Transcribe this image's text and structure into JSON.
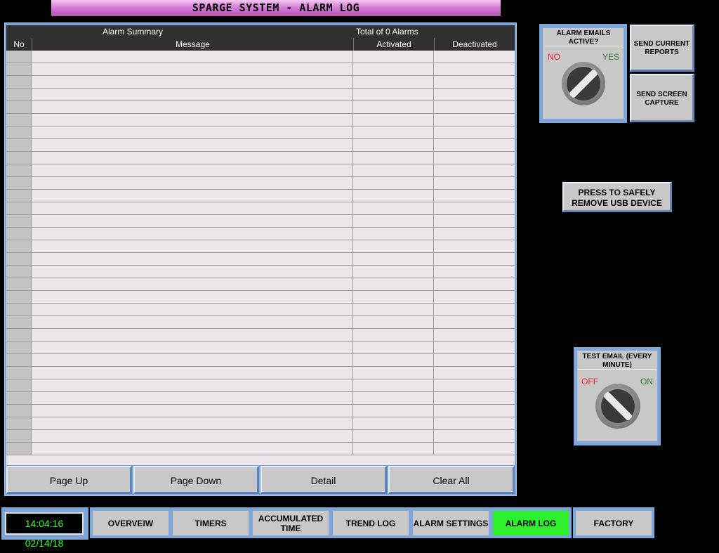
{
  "title": "SPARGE SYSTEM - ALARM LOG",
  "alarm_summary": {
    "label": "Alarm Summary",
    "total": "Total of 0 Alarms",
    "columns": [
      "No",
      "Message",
      "Activated",
      "Deactivated"
    ]
  },
  "pager": {
    "page_up": "Page Up",
    "page_down": "Page Down",
    "detail": "Detail",
    "clear_all": "Clear All"
  },
  "alarm_emails": {
    "label": "ALARM EMAILS ACTIVE?",
    "off": "NO",
    "on": "YES"
  },
  "send_reports": "SEND CURRENT REPORTS",
  "send_screen": "SEND SCREEN CAPTURE",
  "usb": "PRESS TO SAFELY REMOVE USB DEVICE",
  "test_email": {
    "label": "TEST EMAIL (EVERY MINUTE)",
    "off": "OFF",
    "on": "ON"
  },
  "clock": "14:04:16 02/14/18",
  "nav": {
    "overview": "OVERVEIW",
    "timers": "TIMERS",
    "accumulated": "ACCUMULATED TIME",
    "trend": "TREND LOG",
    "alarm_settings": "ALARM SETTINGS",
    "alarm_log": "ALARM LOG",
    "factory": "FACTORY"
  },
  "colors": {
    "active_tab": "#2cf02c",
    "clock_text": "#27ff27",
    "off_label": "#ff2020",
    "on_label": "#2e7d32"
  },
  "icons": [
    "rotary-switch-icon"
  ]
}
